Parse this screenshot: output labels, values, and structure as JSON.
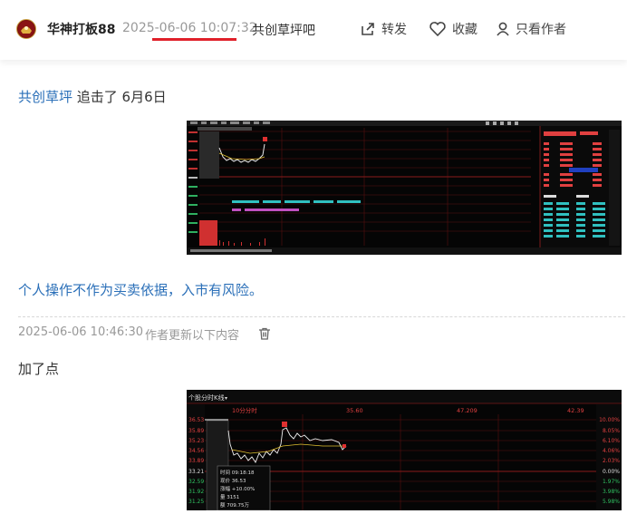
{
  "header": {
    "author": "华神打板88",
    "time": "2025-06-06 10:07:32",
    "topic": "共创草坪吧",
    "actions": {
      "share": "转发",
      "favorite": "收藏",
      "author_only": "只看作者"
    }
  },
  "post": {
    "stock_link": "共创草坪",
    "line1_rest": " 追击了 6月6日",
    "disclaimer": "个人操作不作为买卖依据，入市有风险。"
  },
  "update": {
    "time": "2025-06-06 10:46:30",
    "note": "作者更新以下内容",
    "text": "加了点"
  },
  "chart2": {
    "title": "个股分时K线",
    "tabs": [
      "10分分时",
      "35.60",
      "47.209",
      "42.39"
    ],
    "price_labels": [
      "36.53",
      "35.89",
      "35.23",
      "34.56",
      "33.89",
      "33.21",
      "32.59",
      "31.92",
      "31.25"
    ],
    "pct_labels": [
      "10.00%",
      "8.05%",
      "6.10%",
      "4.06%",
      "2.03%",
      "0.00%",
      "1.97%",
      "3.98%",
      "5.98%"
    ],
    "tooltip": {
      "time": "时间  09:18:18",
      "price": "现价  36.53",
      "change": "涨幅  +10.00%",
      "vol": "量  3151",
      "amount": "额  709.75万"
    }
  }
}
